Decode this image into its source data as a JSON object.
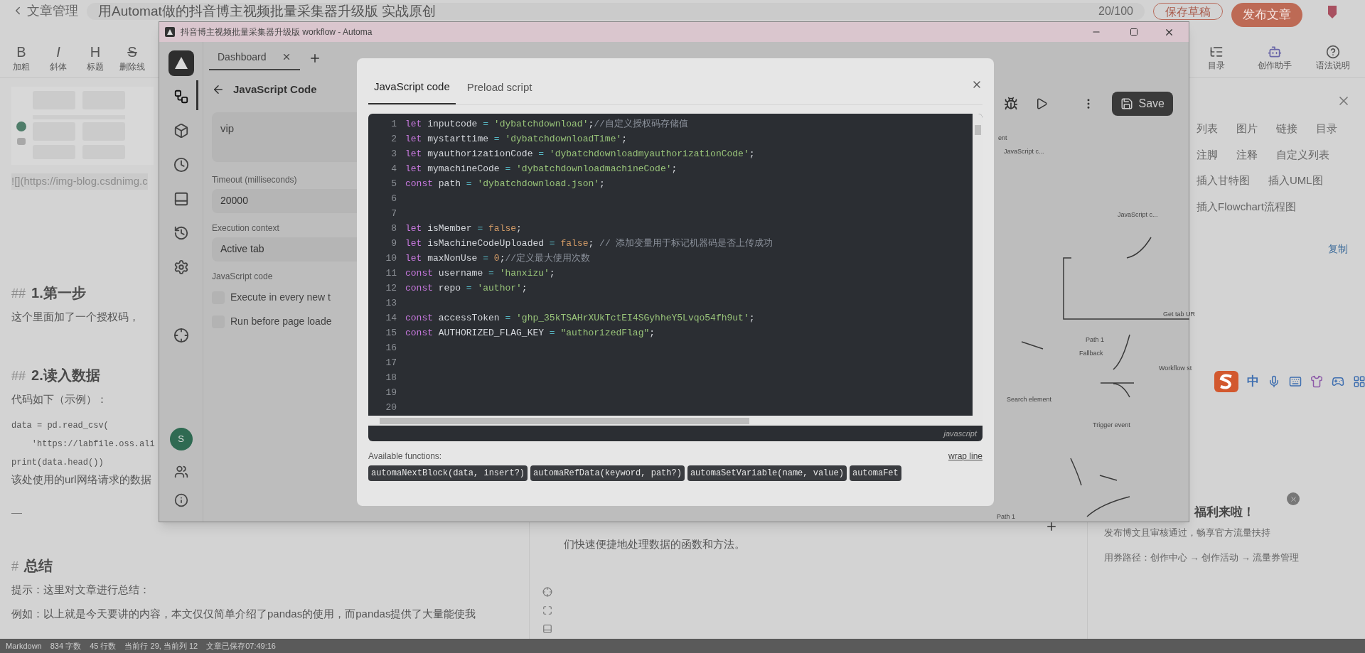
{
  "csdn": {
    "back": "文章管理",
    "title": "用Automat做的抖音博主视频批量采集器升级版 实战原创",
    "count": "20/100",
    "save_draft": "保存草稿",
    "publish": "发布文章",
    "toolbar_left": [
      {
        "glyph": "B",
        "label": "加粗"
      },
      {
        "glyph": "I",
        "label": "斜体"
      },
      {
        "glyph": "H",
        "label": "标题"
      },
      {
        "glyph": "S",
        "label": "删除线"
      }
    ],
    "toolbar_right": [
      {
        "kind": "toc",
        "label": "目录"
      },
      {
        "kind": "robot",
        "label": "创作助手"
      },
      {
        "kind": "help",
        "label": "语法说明"
      }
    ]
  },
  "editor": [
    {
      "kind": "picture"
    },
    {
      "kind": "link",
      "text": "![](https://img-blog.csdnimg.c"
    },
    {
      "kind": "heading",
      "mark": "##",
      "text": "1.第一步"
    },
    {
      "kind": "para",
      "text": "这个里面加了一个授权码，"
    },
    {
      "kind": "heading",
      "mark": "##",
      "text": "2.读入数据"
    },
    {
      "kind": "para",
      "text": "代码如下（示例）："
    },
    {
      "kind": "code",
      "text": "data = pd.read_csv("
    },
    {
      "kind": "code",
      "text": "    'https://labfile.oss.ali"
    },
    {
      "kind": "code",
      "text": "print(data.head())"
    },
    {
      "kind": "para",
      "text": "该处使用的url网络请求的数据"
    },
    {
      "kind": "rule",
      "text": "—"
    },
    {
      "kind": "heading",
      "mark": "#",
      "text": "总结"
    },
    {
      "kind": "para",
      "text": "提示：这里对文章进行总结："
    },
    {
      "kind": "para",
      "text": "例如：以上就是今天要讲的内容，本文仅仅简单介绍了pandas的使用，而pandas提供了大量能使我"
    }
  ],
  "preview": {
    "text": "们快速便捷地处理数据的函数和方法。"
  },
  "right_panel": {
    "options": [
      "列表",
      "图片",
      "链接",
      "目录",
      "注脚",
      "注释",
      "自定义列表",
      "插入甘特图",
      "插入UML图",
      "插入Flowchart流程图"
    ],
    "copy": "复制",
    "ime": "中",
    "promo": {
      "title": "福利来啦！",
      "text": "发布博文且审核通过，畅享官方流量扶持",
      "path": "用券路径：创作中心 → 创作活动 → 流量券管理"
    }
  },
  "status_bar": [
    "Markdown",
    "834 字数",
    "45 行数",
    "当前行 29, 当前列 12",
    "文章已保存07:49:16"
  ],
  "automa": {
    "title": "抖音博主视频批量采集器升级版 workflow - Automa",
    "tab": "Dashboard",
    "avatar": "S",
    "sidebar": [
      {
        "selected": true
      },
      {
        "selected": false
      },
      {
        "selected": false
      },
      {
        "selected": false
      },
      {
        "selected": false
      },
      {
        "selected": false
      },
      {
        "selected": false
      }
    ],
    "panel": {
      "title": "JavaScript Code",
      "description": "vip",
      "timeout_label": "Timeout (milliseconds)",
      "timeout": "20000",
      "context_label": "Execution context",
      "context": "Active tab",
      "code_label": "JavaScript code",
      "options": [
        {
          "label": "Execute in every new t",
          "checked": false
        },
        {
          "label": "Run before page loade",
          "checked": false
        }
      ]
    },
    "save": "Save",
    "nodes": [
      "ent",
      "JavaScript c...",
      "JavaScript c...",
      "Path 1",
      "Fallback",
      "Get tab UR",
      "Workflow st",
      "Search element",
      "Trigger event",
      "Path 1"
    ]
  },
  "modal": {
    "tabs": [
      {
        "label": "JavaScript code",
        "selected": true
      },
      {
        "label": "Preload script",
        "selected": false
      }
    ],
    "lines": [
      {
        "n": "1",
        "parts": [
          {
            "kind": "keyword",
            "t": "let"
          },
          {
            "kind": "plain",
            "t": " inputcode "
          },
          {
            "kind": "operator",
            "t": "="
          },
          {
            "kind": "string",
            "t": " 'dybatchdownload'"
          },
          {
            "kind": "plain",
            "t": ";"
          },
          {
            "kind": "comment",
            "t": "//自定义授权码存储值"
          }
        ]
      },
      {
        "n": "2",
        "parts": [
          {
            "kind": "keyword",
            "t": "let"
          },
          {
            "kind": "plain",
            "t": " mystarttime "
          },
          {
            "kind": "operator",
            "t": "="
          },
          {
            "kind": "string",
            "t": " 'dybatchdownloadTime'"
          },
          {
            "kind": "plain",
            "t": ";"
          }
        ]
      },
      {
        "n": "3",
        "parts": [
          {
            "kind": "keyword",
            "t": "let"
          },
          {
            "kind": "plain",
            "t": " myauthorizationCode "
          },
          {
            "kind": "operator",
            "t": "="
          },
          {
            "kind": "string",
            "t": " 'dybatchdownloadmyauthorizationCode'"
          },
          {
            "kind": "plain",
            "t": ";"
          }
        ]
      },
      {
        "n": "4",
        "parts": [
          {
            "kind": "keyword",
            "t": "let"
          },
          {
            "kind": "plain",
            "t": " mymachineCode "
          },
          {
            "kind": "operator",
            "t": "="
          },
          {
            "kind": "string",
            "t": " 'dybatchdownloadmachineCode'"
          },
          {
            "kind": "plain",
            "t": ";"
          }
        ]
      },
      {
        "n": "5",
        "parts": [
          {
            "kind": "keyword",
            "t": "const"
          },
          {
            "kind": "plain",
            "t": " path "
          },
          {
            "kind": "operator",
            "t": "="
          },
          {
            "kind": "string",
            "t": " 'dybatchdownload.json'"
          },
          {
            "kind": "plain",
            "t": ";"
          }
        ]
      },
      {
        "n": "6"
      },
      {
        "n": "7"
      },
      {
        "n": "8",
        "parts": [
          {
            "kind": "keyword",
            "t": "let"
          },
          {
            "kind": "plain",
            "t": " isMember "
          },
          {
            "kind": "operator",
            "t": "="
          },
          {
            "kind": "atom",
            "t": " false"
          },
          {
            "kind": "plain",
            "t": ";"
          }
        ]
      },
      {
        "n": "9",
        "parts": [
          {
            "kind": "keyword",
            "t": "let"
          },
          {
            "kind": "plain",
            "t": " isMachineCodeUploaded "
          },
          {
            "kind": "operator",
            "t": "="
          },
          {
            "kind": "atom",
            "t": " false"
          },
          {
            "kind": "plain",
            "t": "; "
          },
          {
            "kind": "comment",
            "t": "// 添加变量用于标记机器码是否上传成功"
          }
        ]
      },
      {
        "n": "10",
        "parts": [
          {
            "kind": "keyword",
            "t": "let"
          },
          {
            "kind": "plain",
            "t": " maxNonUse "
          },
          {
            "kind": "operator",
            "t": "="
          },
          {
            "kind": "atom",
            "t": " 0"
          },
          {
            "kind": "plain",
            "t": ";"
          },
          {
            "kind": "comment",
            "t": "//定义最大使用次数"
          }
        ]
      },
      {
        "n": "11",
        "parts": [
          {
            "kind": "keyword",
            "t": "const"
          },
          {
            "kind": "plain",
            "t": " username "
          },
          {
            "kind": "operator",
            "t": "="
          },
          {
            "kind": "string",
            "t": " 'hanxizu'"
          },
          {
            "kind": "plain",
            "t": ";"
          }
        ]
      },
      {
        "n": "12",
        "parts": [
          {
            "kind": "keyword",
            "t": "const"
          },
          {
            "kind": "plain",
            "t": " repo "
          },
          {
            "kind": "operator",
            "t": "="
          },
          {
            "kind": "string",
            "t": " 'author'"
          },
          {
            "kind": "plain",
            "t": ";"
          }
        ]
      },
      {
        "n": "13"
      },
      {
        "n": "14",
        "parts": [
          {
            "kind": "keyword",
            "t": "const"
          },
          {
            "kind": "plain",
            "t": " accessToken "
          },
          {
            "kind": "operator",
            "t": "="
          },
          {
            "kind": "string",
            "t": " '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'"
          },
          {
            "kind": "plain",
            "t": ";"
          }
        ]
      },
      {
        "n": "15",
        "parts": [
          {
            "kind": "keyword",
            "t": "const"
          },
          {
            "kind": "plain",
            "t": " AUTHORIZED_FLAG_KEY "
          },
          {
            "kind": "operator",
            "t": "="
          },
          {
            "kind": "string",
            "t": " \"authorizedFlag\""
          },
          {
            "kind": "plain",
            "t": ";"
          }
        ]
      },
      {
        "n": "16"
      },
      {
        "n": "17"
      },
      {
        "n": "18"
      },
      {
        "n": "19"
      },
      {
        "n": "20"
      }
    ],
    "language": "javascript",
    "functions_label": "Available functions:",
    "wrap": "wrap line",
    "functions": [
      "automaNextBlock(data, insert?)",
      "automaRefData(keyword, path?)",
      "automaSetVariable(name, value)",
      "automaFet"
    ]
  }
}
